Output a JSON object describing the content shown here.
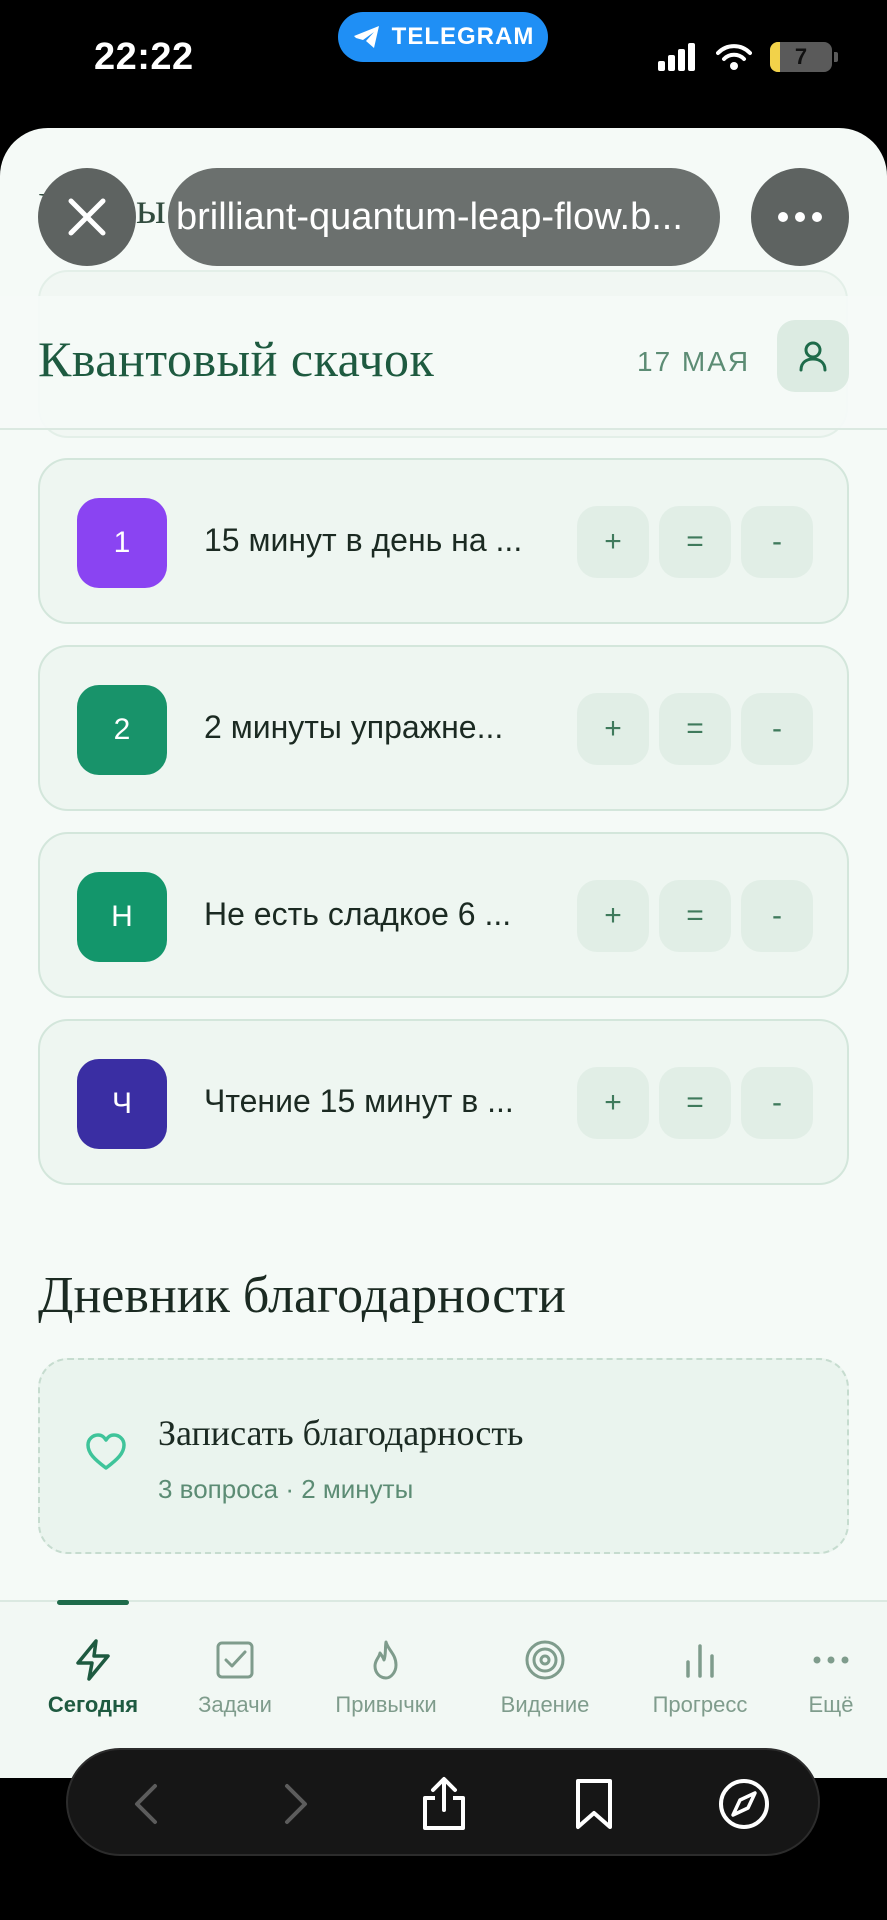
{
  "status_bar": {
    "time": "22:22",
    "telegram_label": "TELEGRAM",
    "battery": "7"
  },
  "browser": {
    "url": "brilliant-quantum-leap-flow.b..."
  },
  "background": {
    "ghost_title": "Привы"
  },
  "header": {
    "title": "Квантовый скачок",
    "date": "17 МАЯ"
  },
  "habits": [
    {
      "badge": "1",
      "name": "15 минут в день на ...",
      "color": "#8a44f2"
    },
    {
      "badge": "2",
      "name": "2 минуты упражне...",
      "color": "#18936a"
    },
    {
      "badge": "Н",
      "name": "Не есть сладкое 6 ...",
      "color": "#13966b"
    },
    {
      "badge": "Ч",
      "name": "Чтение 15 минут в ...",
      "color": "#3a2ea3"
    }
  ],
  "habit_actions": {
    "plus": "+",
    "equal": "=",
    "minus": "-"
  },
  "gratitude": {
    "section_title": "Дневник благодарности",
    "card_title": "Записать благодарность",
    "card_subtitle": "3 вопроса · 2 минуты"
  },
  "nav": {
    "items": [
      {
        "label": "Сегодня",
        "icon": "lightning-icon",
        "active": true
      },
      {
        "label": "Задачи",
        "icon": "checkbox-icon"
      },
      {
        "label": "Привычки",
        "icon": "flame-icon"
      },
      {
        "label": "Видение",
        "icon": "target-icon"
      },
      {
        "label": "Прогресс",
        "icon": "bar-chart-icon"
      },
      {
        "label": "Ещё",
        "icon": "more-icon"
      }
    ]
  },
  "colors": {
    "accent": "#1e5a40",
    "background": "#f5faf7"
  }
}
